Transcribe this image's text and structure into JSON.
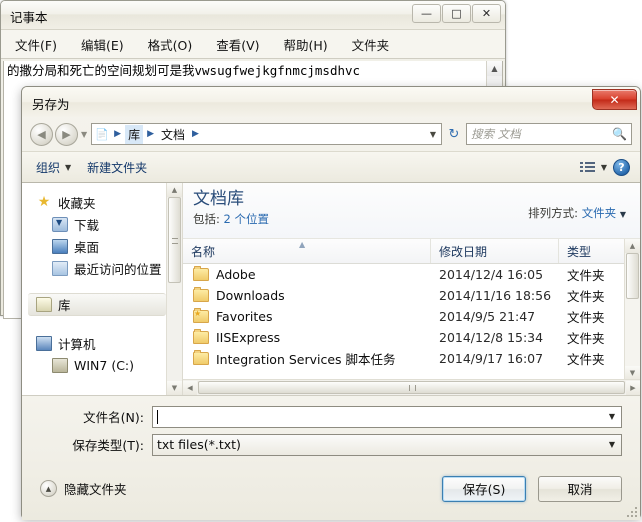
{
  "notepad": {
    "title": "记事本",
    "window_buttons": [
      {
        "name": "minimize",
        "glyph": "—"
      },
      {
        "name": "maximize",
        "glyph": "□"
      },
      {
        "name": "close",
        "glyph": "✕"
      }
    ],
    "menu": [
      "文件(F)",
      "编辑(E)",
      "格式(O)",
      "查看(V)",
      "帮助(H)",
      "文件夹"
    ],
    "document_text": "的撒分局和死亡的空间规划可是我vwsugfwejkgfnmcjmsdhvc"
  },
  "dialog": {
    "title": "另存为",
    "close_glyph": "✕",
    "nav": {
      "back_glyph": "◀",
      "forward_glyph": "▶",
      "history_caret": "▼",
      "breadcrumbs": [
        "库",
        "文档"
      ],
      "breadcrumb_separator": "▶",
      "address_caret": "▼",
      "refresh_glyph": "↻"
    },
    "search": {
      "placeholder": "搜索 文档",
      "icon": "search-icon"
    },
    "toolbar": {
      "organize_label": "组织",
      "organize_caret": "▼",
      "new_folder_label": "新建文件夹",
      "view_caret": "▼",
      "help_label": "?"
    },
    "navpane": {
      "groups": [
        {
          "label": "收藏夹",
          "icon": "star-icon",
          "children": [
            {
              "label": "下载",
              "icon": "downloads-icon"
            },
            {
              "label": "桌面",
              "icon": "desktop-icon"
            },
            {
              "label": "最近访问的位置",
              "icon": "recent-places-icon"
            }
          ]
        },
        {
          "label": "库",
          "icon": "library-icon",
          "selected": true,
          "children": []
        },
        {
          "label": "计算机",
          "icon": "computer-icon",
          "children": [
            {
              "label": "WIN7 (C:)",
              "icon": "drive-icon"
            }
          ]
        }
      ]
    },
    "listpane": {
      "library_title": "文档库",
      "includes_label": "包括:",
      "includes_value": "2 个位置",
      "arrange_label": "排列方式:",
      "arrange_value": "文件夹",
      "arrange_caret": "▼",
      "columns": [
        "名称",
        "修改日期",
        "类型"
      ],
      "sort_indicator": "▲",
      "rows": [
        {
          "name": "Adobe",
          "modified": "2014/12/4 16:05",
          "type": "文件夹",
          "icon": "folder-icon"
        },
        {
          "name": "Downloads",
          "modified": "2014/11/16 18:56",
          "type": "文件夹",
          "icon": "folder-icon"
        },
        {
          "name": "Favorites",
          "modified": "2014/9/5 21:47",
          "type": "文件夹",
          "icon": "folder-star-icon"
        },
        {
          "name": "IISExpress",
          "modified": "2014/12/8 15:34",
          "type": "文件夹",
          "icon": "folder-icon"
        },
        {
          "name": "Integration Services 脚本任务",
          "modified": "2014/9/17 16:07",
          "type": "文件夹",
          "icon": "folder-icon"
        }
      ]
    },
    "form": {
      "filename_label": "文件名(N):",
      "filename_value": "",
      "filetype_label": "保存类型(T):",
      "filetype_value": "txt files(*.txt)",
      "caret": "▼"
    },
    "footer": {
      "hide_folders_label": "隐藏文件夹",
      "hide_folders_glyph": "▲",
      "save_label": "保存(S)",
      "cancel_label": "取消"
    }
  },
  "colors": {
    "accent_blue": "#2a6ab0",
    "library_title": "#2a4d7a",
    "close_red": "#d9402c",
    "default_button_border": "#3c7fb1"
  }
}
